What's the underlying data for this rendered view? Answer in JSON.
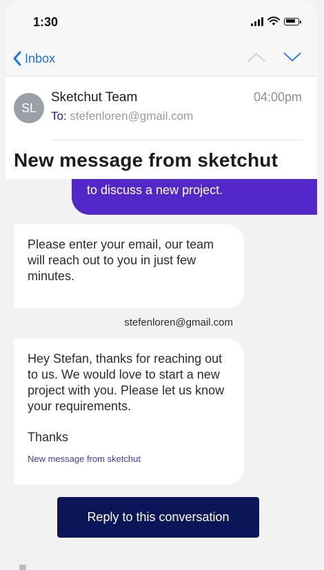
{
  "status_bar": {
    "time": "1:30"
  },
  "nav": {
    "back_label": "Inbox"
  },
  "email": {
    "avatar_initials": "SL",
    "sender": "Sketchut Team",
    "to_label": "To:",
    "to_address": "stefenloren@gmail.com",
    "time": "04:00pm",
    "subject": "New message from sketchut"
  },
  "thread": {
    "outgoing_text": "to discuss a new project.",
    "message1": "Please enter your email, our team will reach out to you in just few minutes.",
    "user_email": "stefenloren@gmail.com",
    "message2": "Hey Stefan, thanks for reaching out to us. We would love to start a new project with you. Please let us know your requirements.",
    "message2_signoff": "Thanks",
    "message2_link": "New message from sketchut"
  },
  "actions": {
    "reply_label": "Reply to this conversation"
  },
  "colors": {
    "accent": "#1a73e8",
    "bubble_out": "#5427c9",
    "button": "#0b1658"
  }
}
